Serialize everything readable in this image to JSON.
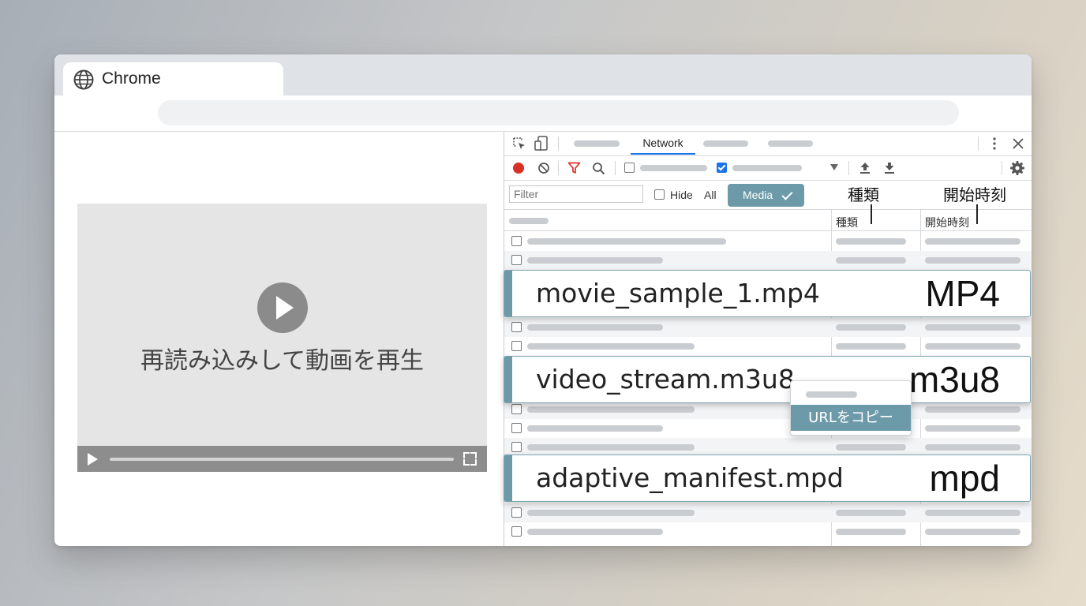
{
  "browser": {
    "tab_title": "Chrome"
  },
  "page": {
    "reload_message": "再読み込みして動画を再生"
  },
  "devtools": {
    "tabs": {
      "network_label": "Network"
    },
    "filter": {
      "placeholder": "Filter",
      "hide_label": "Hide",
      "all_label": "All",
      "media_label": "Media"
    },
    "callouts": {
      "type": "種類",
      "start_time": "開始時刻"
    },
    "table": {
      "headers": {
        "type": "種類",
        "start_time": "開始時刻"
      },
      "highlighted_rows": [
        {
          "name": "movie_sample_1.mp4",
          "type": "MP4"
        },
        {
          "name": "video_stream.m3u8",
          "type": "m3u8"
        },
        {
          "name": "adaptive_manifest.mpd",
          "type": "mpd"
        }
      ]
    },
    "context_menu": {
      "copy_url_label": "URLをコピー"
    }
  },
  "colors": {
    "accent": "#6d9aa9",
    "record": "#d93025",
    "filter_icon": "#d93025"
  }
}
